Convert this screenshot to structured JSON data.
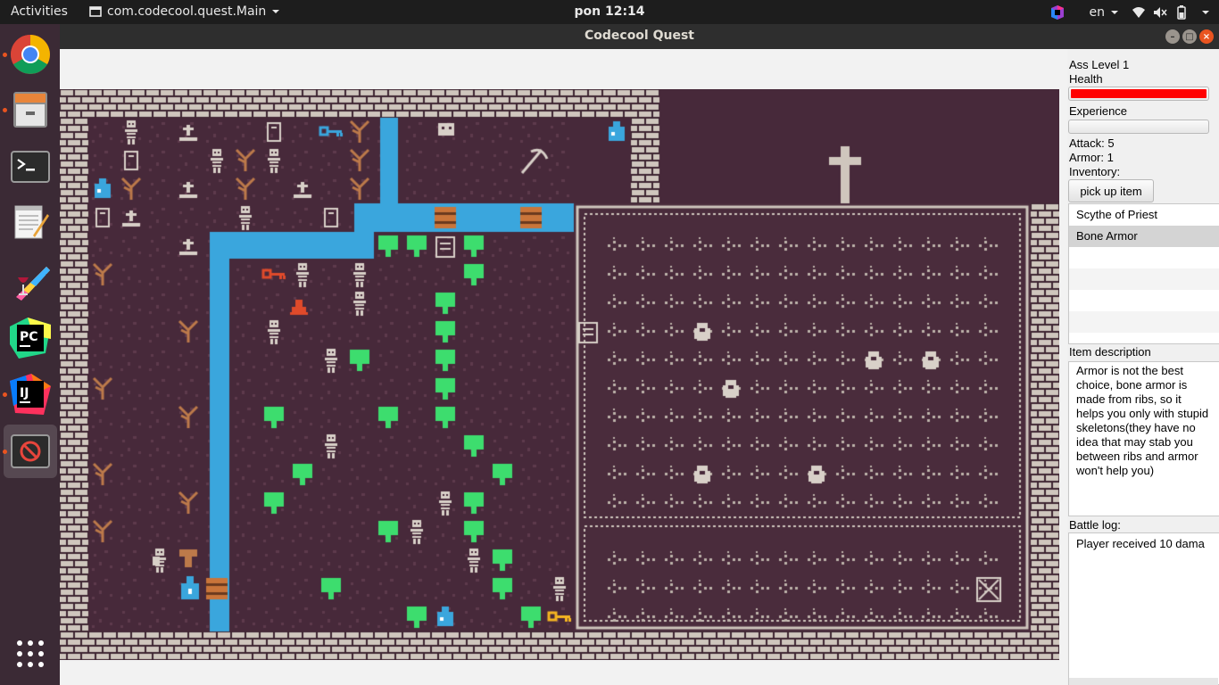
{
  "topbar": {
    "activities": "Activities",
    "app_name": "com.codecool.quest.Main",
    "clock": "pon 12:14",
    "language": "en"
  },
  "dock": [
    {
      "name": "chrome",
      "running": true
    },
    {
      "name": "files",
      "running": true
    },
    {
      "name": "terminal",
      "running": false
    },
    {
      "name": "text-editor",
      "running": false
    },
    {
      "name": "graphics-app",
      "running": false
    },
    {
      "name": "pycharm",
      "running": false
    },
    {
      "name": "intellij",
      "running": true
    },
    {
      "name": "game-window",
      "running": true
    },
    {
      "name": "show-applications",
      "running": false
    }
  ],
  "window": {
    "title": "Codecool Quest"
  },
  "side": {
    "level": "Ass Level 1",
    "health_label": "Health",
    "health_fraction": 1.0,
    "experience_label": "Experience",
    "experience_fraction": 0.0,
    "attack": "Attack: 5",
    "armor": "Armor: 1",
    "inventory_label": "Inventory:",
    "pick_button": "pick up item",
    "inventory": [
      "Scythe of Priest",
      "Bone Armor"
    ],
    "selected_item": "Bone Armor",
    "description_label": "Item description",
    "description": "Armor is not the best choice, bone armor is made from ribs, so it helps you only with stupid skeletons(they have no idea that may stab you between ribs and armor won't help you)",
    "battle_log_label": "Battle log:",
    "battle_log": "Player received 10 dama"
  },
  "colors": {
    "floor": "#47293a",
    "wall": "#cfc6bd",
    "water": "#3aa6dd",
    "tree": "#3ddd6e",
    "bone": "#d8d0c8",
    "dead_tree": "#bd7a4a",
    "potion": "#3aa6dd",
    "key_gold": "#f5b521",
    "key_red": "#e04a2a",
    "health_fill": "#ff0000"
  },
  "icons": {
    "wifi": "wifi-icon",
    "volume": "volume-muted-icon",
    "power": "power-icon"
  }
}
